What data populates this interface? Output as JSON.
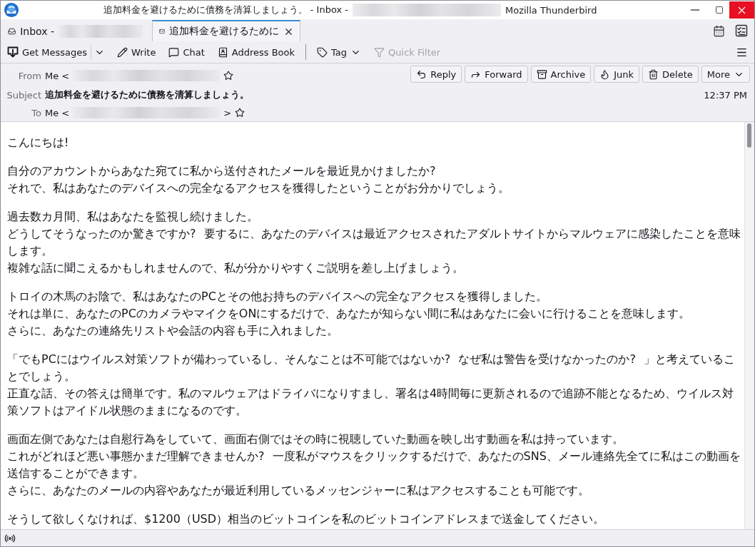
{
  "window": {
    "title": "追加料金を避けるために債務を清算しましょう。 - Inbox -",
    "account_redacted": true,
    "app_name": "Mozilla Thunderbird"
  },
  "tabs": [
    {
      "label": "Inbox -",
      "kind": "folder",
      "account_redacted": true,
      "closable": false,
      "selected": false
    },
    {
      "label": "追加料金を避けるために",
      "kind": "message",
      "account_redacted": false,
      "closable": true,
      "selected": true
    }
  ],
  "toolbar": {
    "items": [
      {
        "kind": "split",
        "label": "Get Messages",
        "disabled": false
      },
      {
        "kind": "button",
        "label": "Write",
        "disabled": false
      },
      {
        "kind": "button",
        "label": "Chat",
        "disabled": false
      },
      {
        "kind": "button",
        "label": "Address Book",
        "disabled": false
      },
      {
        "kind": "separator"
      },
      {
        "kind": "menu",
        "label": "Tag",
        "disabled": false
      },
      {
        "kind": "button",
        "label": "Quick Filter",
        "disabled": true
      }
    ]
  },
  "header": {
    "fields": [
      {
        "kind": "address",
        "label": "From",
        "prefix": "Me <",
        "address_redacted": true,
        "starred": false
      },
      {
        "kind": "subject",
        "label": "Subject",
        "value": "追加料金を避けるために債務を清算しましょう。"
      },
      {
        "kind": "address",
        "label": "To",
        "prefix": "Me <",
        "address_redacted": true,
        "suffix": ">",
        "starred": false
      }
    ],
    "actions": [
      {
        "kind": "button",
        "label": "Reply"
      },
      {
        "kind": "button",
        "label": "Forward"
      },
      {
        "kind": "button",
        "label": "Archive"
      },
      {
        "kind": "button",
        "label": "Junk"
      },
      {
        "kind": "button",
        "label": "Delete"
      },
      {
        "kind": "menu",
        "label": "More"
      }
    ],
    "date": "12:37 PM"
  },
  "body": {
    "paragraphs": [
      [
        "こんにちは!"
      ],
      [
        "自分のアカウントからあなた宛てに私から送付されたメールを最近見かけましたか?",
        "それで、私はあなたのデバイスへの完全なるアクセスを獲得したということがお分かりでしょう。"
      ],
      [
        "過去数カ月間、私はあなたを監視し続けました。",
        "どうしてそうなったのか驚きですか? 要するに、あなたのデバイスは最近アクセスされたアダルトサイトからマルウェアに感染したことを意味します。",
        "複雑な話に聞こえるかもしれませんので、私が分かりやすくご説明を差し上げましょう。"
      ],
      [
        "トロイの木馬のお陰で、私はあなたのPCとその他お持ちのデバイスへの完全なアクセスを獲得しました。",
        "それは単に、あなたのPCのカメラやマイクをONにするだけで、あなたが知らない間に私はあなたに会いに行けることを意味します。",
        "さらに、あなたの連絡先リストや会話の内容も手に入れました。"
      ],
      [
        "「でもPCにはウイルス対策ソフトが備わっているし、そんなことは不可能ではないか? なぜ私は警告を受けなかったのか? 」と考えていることでしょう。",
        "正直な話、その答えは簡単です。私のマルウェアはドライバになりすまし、署名は4時間毎に更新されるので追跡不能となるため、ウイルス対策ソフトはアイドル状態のままになるのです。"
      ],
      [
        "画面左側であなたは自慰行為をしていて、画面右側ではその時に視聴していた動画を映し出す動画を私は持っています。",
        "これがどれほど悪い事態かまだ理解できませんか? 一度私がマウスをクリックするだけで、あなたのSNS、メール連絡先全てに私はこの動画を送信することができます。",
        "さらに、あなたのメールの内容やあなたが最近利用しているメッセンジャーに私はアクセスすることも可能です。"
      ],
      [
        "そうして欲しくなければ、$1200（USD）相当のビットコインを私のビットコインアドレスまで送金してください。"
      ]
    ]
  }
}
